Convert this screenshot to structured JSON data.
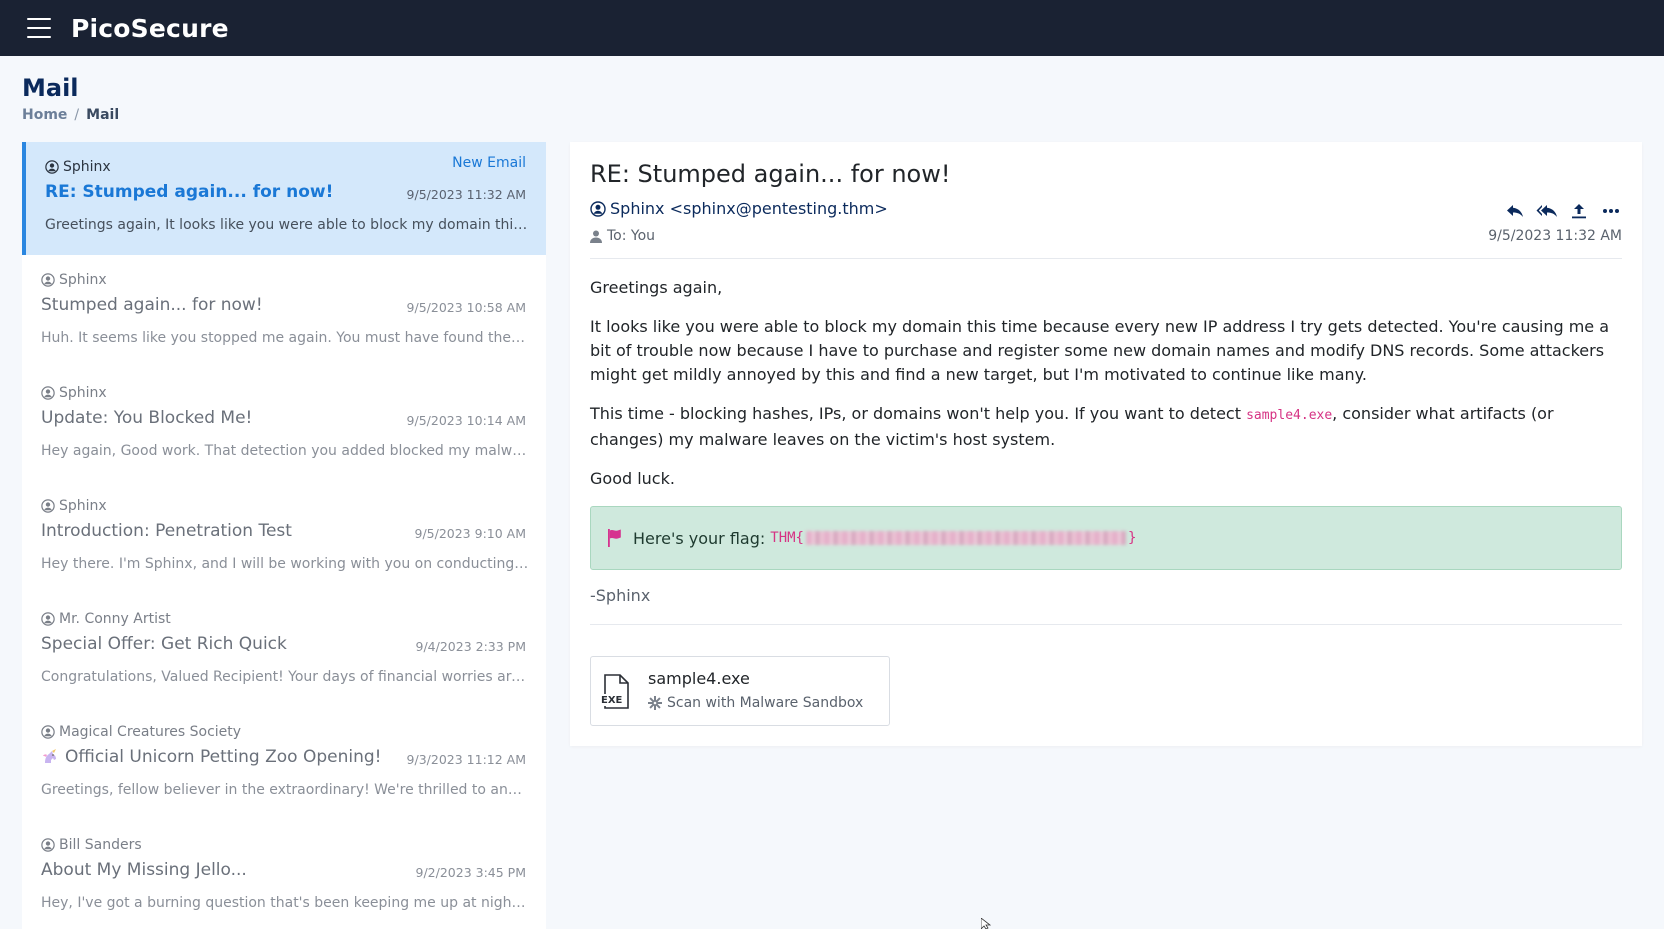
{
  "app": {
    "brand": "PicoSecure"
  },
  "page": {
    "title": "Mail",
    "breadcrumb": {
      "home": "Home",
      "separator": "/",
      "current": "Mail"
    }
  },
  "mail_list": [
    {
      "sender": "Sphinx",
      "subject": "RE: Stumped again... for now!",
      "date": "9/5/2023 11:32 AM",
      "preview": "Greetings again, It looks like you were able to block my domain this time because every new IP address I try gets detected.",
      "badge": "New Email",
      "active": true
    },
    {
      "sender": "Sphinx",
      "subject": "Stumped again... for now!",
      "date": "9/5/2023 10:58 AM",
      "preview": "Huh. It seems like you stopped me again. You must have found the IP address my malware was connecting to."
    },
    {
      "sender": "Sphinx",
      "subject": "Update: You Blocked Me!",
      "date": "9/5/2023 10:14 AM",
      "preview": "Hey again, Good work. That detection you added blocked my malware from running again."
    },
    {
      "sender": "Sphinx",
      "subject": "Introduction: Penetration Test",
      "date": "9/5/2023 9:10 AM",
      "preview": "Hey there. I'm Sphinx, and I will be working with you on conducting three rounds of penetration testing."
    },
    {
      "sender": "Mr. Conny Artist",
      "subject": "Special Offer: Get Rich Quick",
      "date": "9/4/2023 2:33 PM",
      "preview": "Congratulations, Valued Recipient! Your days of financial worries are over with this exclusive offer."
    },
    {
      "sender": "Magical Creatures Society",
      "subject": "Official Unicorn Petting Zoo Opening!",
      "subject_icon": "unicorn-icon",
      "date": "9/3/2023 11:12 AM",
      "preview": "Greetings, fellow believer in the extraordinary! We're thrilled to announce the grand opening."
    },
    {
      "sender": "Bill Sanders",
      "subject": "About My Missing Jello...",
      "date": "9/2/2023 3:45 PM",
      "preview": "Hey, I've got a burning question that's been keeping me up at night... well, most nights."
    }
  ],
  "mail_view": {
    "subject": "RE: Stumped again... for now!",
    "from": "Sphinx <sphinx@pentesting.thm>",
    "to": "To: You",
    "date": "9/5/2023 11:32 AM",
    "actions": [
      "reply-icon",
      "reply-all-icon",
      "forward-icon",
      "more-icon"
    ],
    "body": {
      "greeting": "Greetings again,",
      "p1": "It looks like you were able to block my domain this time because every new IP address I try gets detected. You're causing me a bit of trouble now because I have to purchase and register some new domain names and modify DNS records. Some attackers might get mildly annoyed by this and find a new target, but I'm motivated to continue like many.",
      "p2_before": "This time - blocking hashes, IPs, or domains won't help you. If you want to detect ",
      "p2_code": "sample4.exe",
      "p2_after": ", consider what artifacts (or changes) my malware leaves on the victim's host system.",
      "closing": "Good luck."
    },
    "flag": {
      "label": "Here's your flag:",
      "prefix": "THM{",
      "suffix": "}"
    },
    "signature": "-Sphinx",
    "attachment": {
      "name": "sample4.exe",
      "type_label": "EXE",
      "action": "Scan with Malware Sandbox"
    }
  }
}
